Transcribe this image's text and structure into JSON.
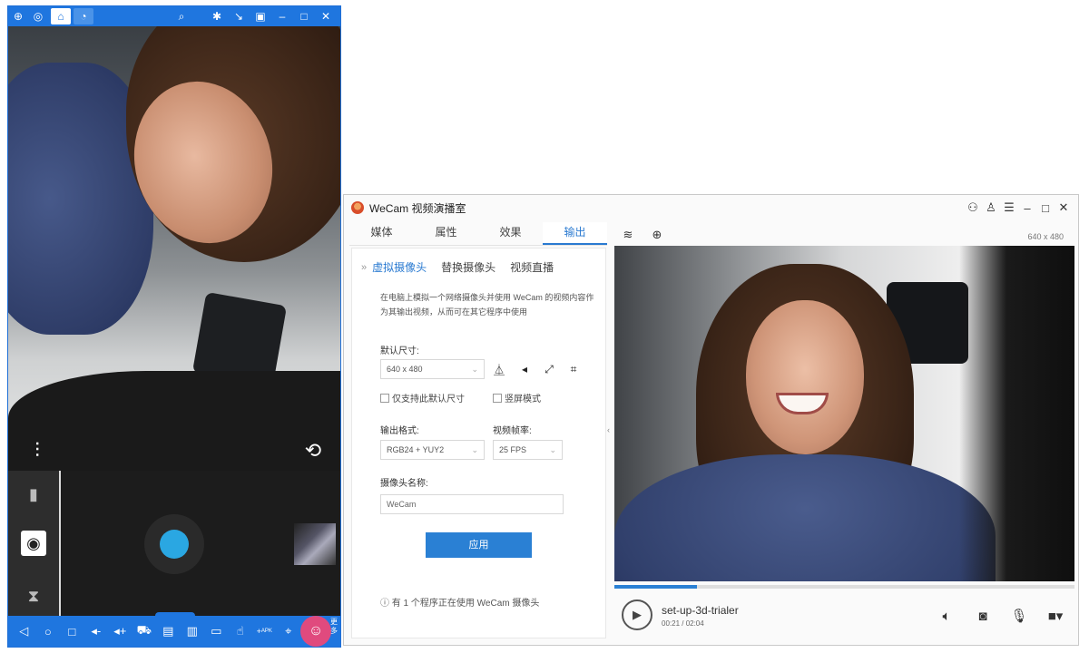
{
  "emulator": {
    "titlebar": {
      "icons": [
        "gift-icon",
        "user-icon",
        "home-icon",
        "app-icon",
        "search-icon",
        "pin-icon",
        "shrink-icon",
        "restore-icon",
        "minimize-icon",
        "maximize-icon",
        "close-icon"
      ]
    },
    "nav": {
      "more_label": "更多",
      "icons": [
        "back-icon",
        "home-circle-icon",
        "recent-icon",
        "volume-down-icon",
        "volume-up-icon",
        "car-icon",
        "case-icon",
        "trash-icon",
        "subtitle-icon",
        "touch-icon",
        "apk-icon",
        "location-icon",
        "wecam-icon"
      ],
      "apk_label": "APK"
    }
  },
  "wecam": {
    "title": "WeCam 视频演播室",
    "tabs": [
      {
        "label": "媒体"
      },
      {
        "label": "属性"
      },
      {
        "label": "效果"
      },
      {
        "label": "输出"
      }
    ],
    "subtabs": [
      {
        "label": "虚拟摄像头"
      },
      {
        "label": "替换摄像头"
      },
      {
        "label": "视频直播"
      }
    ],
    "description": "在电脑上模拟一个网络摄像头并使用 WeCam 的视频内容作为其输出视频，从而可在其它程序中使用",
    "size_label": "默认尺寸:",
    "size_value": "640 x 480",
    "only_default_label": "仅支持此默认尺寸",
    "portrait_label": "竖屏模式",
    "format_label": "输出格式:",
    "format_value": "RGB24 + YUY2",
    "fps_label": "视频帧率:",
    "fps_value": "25 FPS",
    "camera_name_label": "摄像头名称:",
    "camera_name_value": "WeCam",
    "apply_label": "应用",
    "status": "ⓘ 有 1 个程序正在使用 WeCam 摄像头",
    "resolution": "640 x 480",
    "player": {
      "file_name": "set-up-3d-trialer",
      "time": "00:21 / 02:04",
      "progress": 0.18
    },
    "accent_color": "#2a80d4"
  }
}
